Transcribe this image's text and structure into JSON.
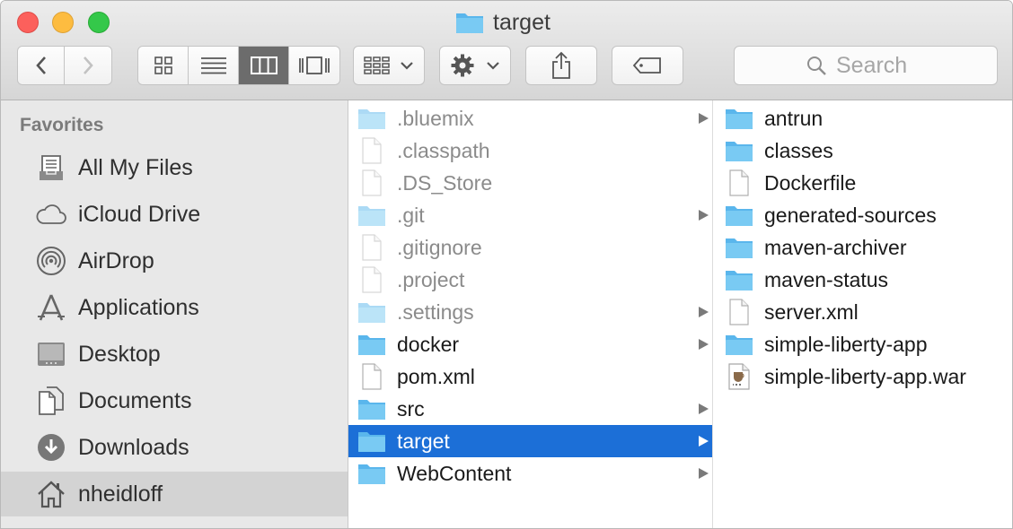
{
  "window": {
    "title": "target"
  },
  "toolbar": {
    "search_placeholder": "Search",
    "view_modes": [
      "icon-view",
      "list-view",
      "column-view",
      "cover-flow-view"
    ],
    "active_view": "column-view"
  },
  "sidebar": {
    "header": "Favorites",
    "items": [
      {
        "label": "All My Files",
        "icon": "all-my-files-icon"
      },
      {
        "label": "iCloud Drive",
        "icon": "icloud-icon"
      },
      {
        "label": "AirDrop",
        "icon": "airdrop-icon"
      },
      {
        "label": "Applications",
        "icon": "applications-icon"
      },
      {
        "label": "Desktop",
        "icon": "desktop-icon"
      },
      {
        "label": "Documents",
        "icon": "documents-icon"
      },
      {
        "label": "Downloads",
        "icon": "downloads-icon"
      },
      {
        "label": "nheidloff",
        "icon": "home-icon"
      }
    ],
    "selected": "nheidloff"
  },
  "column1": {
    "items": [
      {
        "name": ".bluemix",
        "type": "folder"
      },
      {
        "name": ".classpath",
        "type": "file"
      },
      {
        "name": ".DS_Store",
        "type": "file"
      },
      {
        "name": ".git",
        "type": "folder"
      },
      {
        "name": ".gitignore",
        "type": "file"
      },
      {
        "name": ".project",
        "type": "file"
      },
      {
        "name": ".settings",
        "type": "folder"
      },
      {
        "name": "docker",
        "type": "folder"
      },
      {
        "name": "pom.xml",
        "type": "file"
      },
      {
        "name": "src",
        "type": "folder"
      },
      {
        "name": "target",
        "type": "folder"
      },
      {
        "name": "WebContent",
        "type": "folder"
      }
    ],
    "selected": "target"
  },
  "column2": {
    "items": [
      {
        "name": "antrun",
        "type": "folder"
      },
      {
        "name": "classes",
        "type": "folder"
      },
      {
        "name": "Dockerfile",
        "type": "file"
      },
      {
        "name": "generated-sources",
        "type": "folder"
      },
      {
        "name": "maven-archiver",
        "type": "folder"
      },
      {
        "name": "maven-status",
        "type": "folder"
      },
      {
        "name": "server.xml",
        "type": "file"
      },
      {
        "name": "simple-liberty-app",
        "type": "folder"
      },
      {
        "name": "simple-liberty-app.war",
        "type": "jar"
      }
    ]
  },
  "colors": {
    "selection": "#1c6fd7",
    "folder": "#6fc2f1",
    "sidebar_bg": "#e8e8e8"
  }
}
